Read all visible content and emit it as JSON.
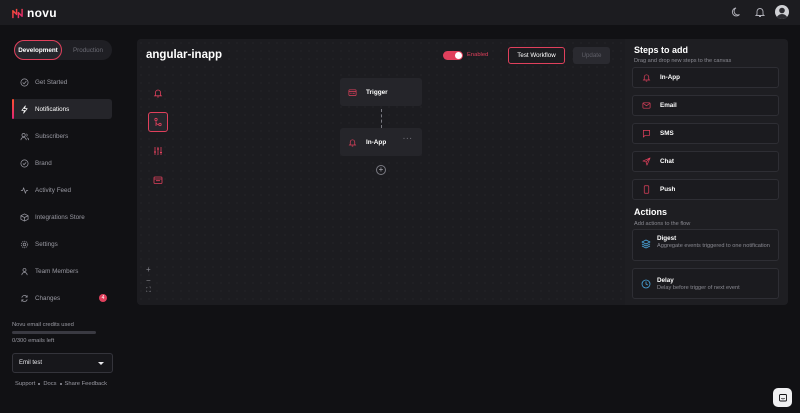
{
  "app": {
    "name": "novu",
    "brand_color": "#e0405c"
  },
  "topbar": {
    "theme_icon": "moon-icon",
    "bell_icon": "bell-icon",
    "avatar_icon": "user-avatar"
  },
  "environment": {
    "development_label": "Development",
    "production_label": "Production",
    "selected": "Development"
  },
  "sidebar": {
    "items": [
      {
        "label": "Get Started",
        "icon": "check-circle-icon"
      },
      {
        "label": "Notifications",
        "icon": "bolt-icon",
        "active": true
      },
      {
        "label": "Subscribers",
        "icon": "users-icon"
      },
      {
        "label": "Brand",
        "icon": "badge-check-icon"
      },
      {
        "label": "Activity Feed",
        "icon": "activity-icon"
      },
      {
        "label": "Integrations Store",
        "icon": "box-icon"
      },
      {
        "label": "Settings",
        "icon": "gear-icon"
      },
      {
        "label": "Team Members",
        "icon": "team-icon"
      },
      {
        "label": "Changes",
        "icon": "sync-icon",
        "badge": "4"
      }
    ],
    "credits_label": "Novu email credits used",
    "credits_used_fraction": 0.0,
    "credits_count": "0/300 emails left",
    "org_select_value": "Emil test",
    "footer_links": [
      "Support",
      "Docs",
      "Share Feedback"
    ]
  },
  "workflow": {
    "title": "angular-inapp",
    "enabled_label": "Enabled",
    "enabled": true,
    "test_button": "Test Workflow",
    "update_button": "Update",
    "tools": [
      "bell-icon",
      "branch-icon",
      "sliders-icon",
      "table-icon"
    ],
    "nodes": [
      {
        "label": "Trigger",
        "icon": "trigger-icon"
      },
      {
        "label": "In-App",
        "icon": "bell-icon",
        "more": "···"
      }
    ],
    "add_step_symbol": "+",
    "zoom_controls": [
      "+",
      "−",
      "⛶"
    ]
  },
  "steps_panel": {
    "title": "Steps to add",
    "subtitle": "Drag and drop new steps to the canvas",
    "steps": [
      {
        "label": "In-App",
        "icon": "bell-icon"
      },
      {
        "label": "Email",
        "icon": "mail-icon"
      },
      {
        "label": "SMS",
        "icon": "sms-icon"
      },
      {
        "label": "Chat",
        "icon": "send-icon"
      },
      {
        "label": "Push",
        "icon": "mobile-icon"
      }
    ],
    "actions_title": "Actions",
    "actions_subtitle": "Add actions to the flow",
    "actions": [
      {
        "label": "Digest",
        "description": "Aggregate events triggered to one notification",
        "icon": "layers-icon"
      },
      {
        "label": "Delay",
        "description": "Delay before trigger of next event",
        "icon": "clock-icon"
      }
    ]
  },
  "chat_fab_icon": "chat-icon"
}
